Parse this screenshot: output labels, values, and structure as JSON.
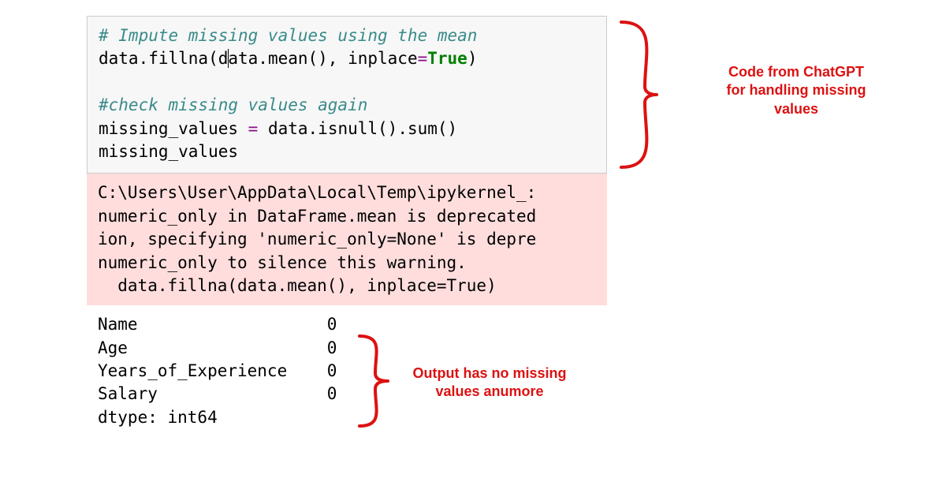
{
  "code": {
    "line1_comment": "# Impute missing values using the mean",
    "line2_a": "data.fillna(d",
    "line2_b": "ata.mean(), inplace",
    "line2_eq": "=",
    "line2_true": "True",
    "line2_end": ")",
    "line3": "",
    "line4_comment": "#check missing values again",
    "line5_a": "missing_values ",
    "line5_eq": "=",
    "line5_b": " data.isnull().sum()",
    "line6": "missing_values"
  },
  "warning": {
    "l1": "C:\\Users\\User\\AppData\\Local\\Temp\\ipykernel_:",
    "l2": "numeric_only in DataFrame.mean is deprecated",
    "l3": "ion, specifying 'numeric_only=None' is depre",
    "l4": "numeric_only to silence this warning.",
    "l5": "  data.fillna(data.mean(), inplace=True)"
  },
  "output": {
    "rows": [
      {
        "label": "Name",
        "value": "0"
      },
      {
        "label": "Age",
        "value": "0"
      },
      {
        "label": "Years_of_Experience",
        "value": "0"
      },
      {
        "label": "Salary",
        "value": "0"
      }
    ],
    "dtype": "dtype: int64"
  },
  "annotations": {
    "top": "Code from ChatGPT\nfor handling missing\nvalues",
    "bottom": "Output has no missing\nvalues anumore"
  }
}
